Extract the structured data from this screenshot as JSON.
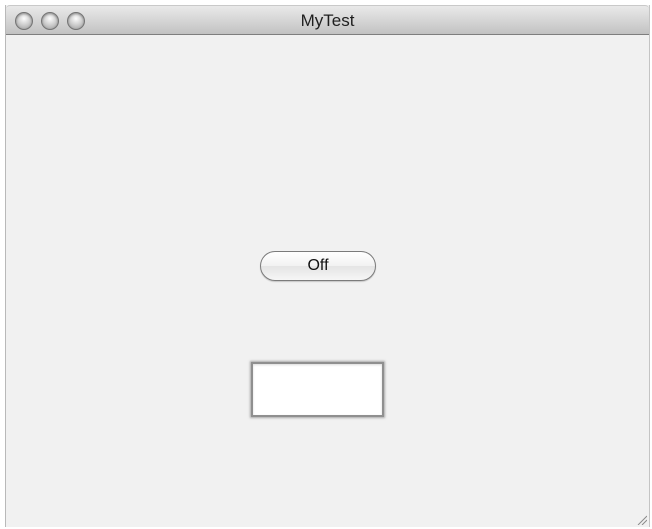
{
  "window": {
    "title": "MyTest",
    "controls": {
      "close": "close-icon",
      "minimize": "minimize-icon",
      "zoom": "zoom-icon"
    }
  },
  "main": {
    "toggle_button_label": "Off",
    "text_field_value": ""
  },
  "colors": {
    "window_background": "#f1f1f1",
    "titlebar_top": "#e9e9e9",
    "titlebar_bottom": "#c2c2c2"
  }
}
